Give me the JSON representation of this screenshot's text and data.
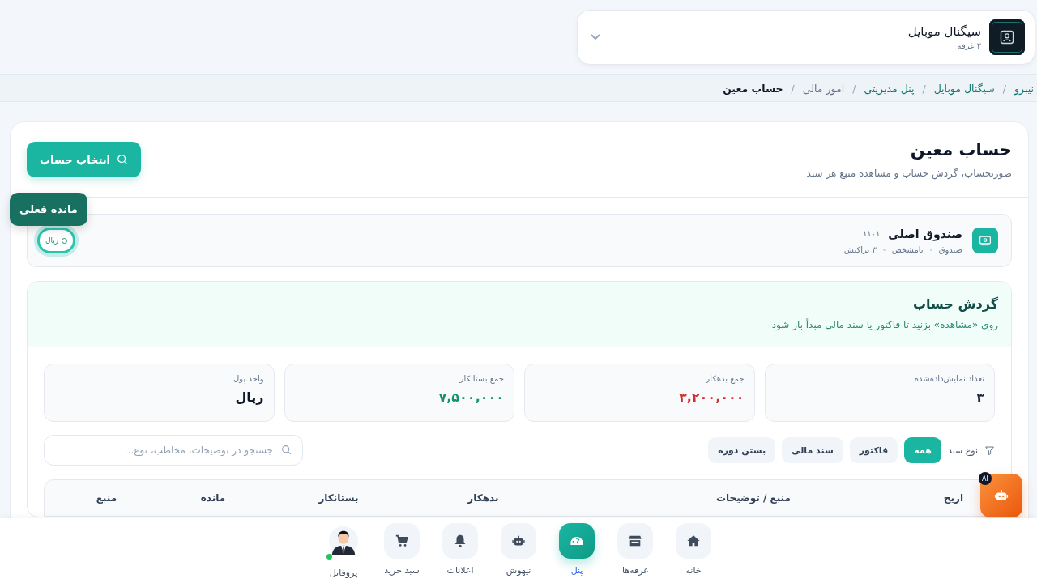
{
  "store_selector": {
    "name": "سیگنال موبایل",
    "subtitle": "۲ غرفه"
  },
  "breadcrumb": [
    {
      "label": "نیبرو",
      "kind": "link"
    },
    {
      "label": "سیگنال موبایل",
      "kind": "link",
      "separator": "/"
    },
    {
      "label": "پنل مدیریتی",
      "kind": "link",
      "separator": "/"
    },
    {
      "label": "امور مالی",
      "kind": "text",
      "separator": "/"
    },
    {
      "label": "حساب معین",
      "kind": "current",
      "separator": "/"
    }
  ],
  "page": {
    "title": "حساب معین",
    "subtitle": "صورتحساب، گردش حساب و مشاهده منبع هر سند",
    "select_button": "انتخاب حساب"
  },
  "account": {
    "name": "صندوق اصلی",
    "code": "۱۱۰۱",
    "meta": [
      "صندوق",
      "نامشخص",
      "۳ تراکنش"
    ],
    "balance_unit": "ریال",
    "tooltip": "مانده فعلی"
  },
  "ledger": {
    "title": "گردش حساب",
    "hint": "روی «مشاهده» بزنید تا فاکتور یا سند مالی مبدأ باز شود"
  },
  "stats": [
    {
      "label": "تعداد نمایش‌داده‌شده",
      "value": "۳",
      "color": "#1f2937"
    },
    {
      "label": "جمع بدهکار",
      "value": "۳,۲۰۰,۰۰۰",
      "color": "#d12f2f"
    },
    {
      "label": "جمع بستانکار",
      "value": "۷,۵۰۰,۰۰۰",
      "color": "#12936a"
    },
    {
      "label": "واحد پول",
      "value": "ریال",
      "color": "#111827"
    }
  ],
  "filter": {
    "label": "نوع سند",
    "chips": [
      {
        "label": "همه",
        "selected": true
      },
      {
        "label": "فاکتور",
        "selected": false
      },
      {
        "label": "سند مالی",
        "selected": false
      },
      {
        "label": "بستن دوره",
        "selected": false
      }
    ]
  },
  "search": {
    "placeholder": "جستجو در توضیحات، مخاطب، نوع..."
  },
  "table": {
    "columns": [
      "اریخ",
      "منبع / توضیحات",
      "بدهکار",
      "بستانکار",
      "مانده",
      "منبع"
    ]
  },
  "ai_button": {
    "badge": "AI"
  },
  "bottom_nav": [
    {
      "label": "خانه",
      "kind": "home",
      "selected": false
    },
    {
      "label": "غرفه‌ها",
      "kind": "store",
      "selected": false
    },
    {
      "label": "پنل",
      "kind": "gauge",
      "selected": true
    },
    {
      "label": "نیهوش",
      "kind": "robot",
      "selected": false
    },
    {
      "label": "اعلانات",
      "kind": "bell",
      "selected": false
    },
    {
      "label": "سبد خرید",
      "kind": "cart",
      "selected": false
    },
    {
      "label": "پروفایل",
      "kind": "profile",
      "selected": false,
      "online": true
    }
  ]
}
